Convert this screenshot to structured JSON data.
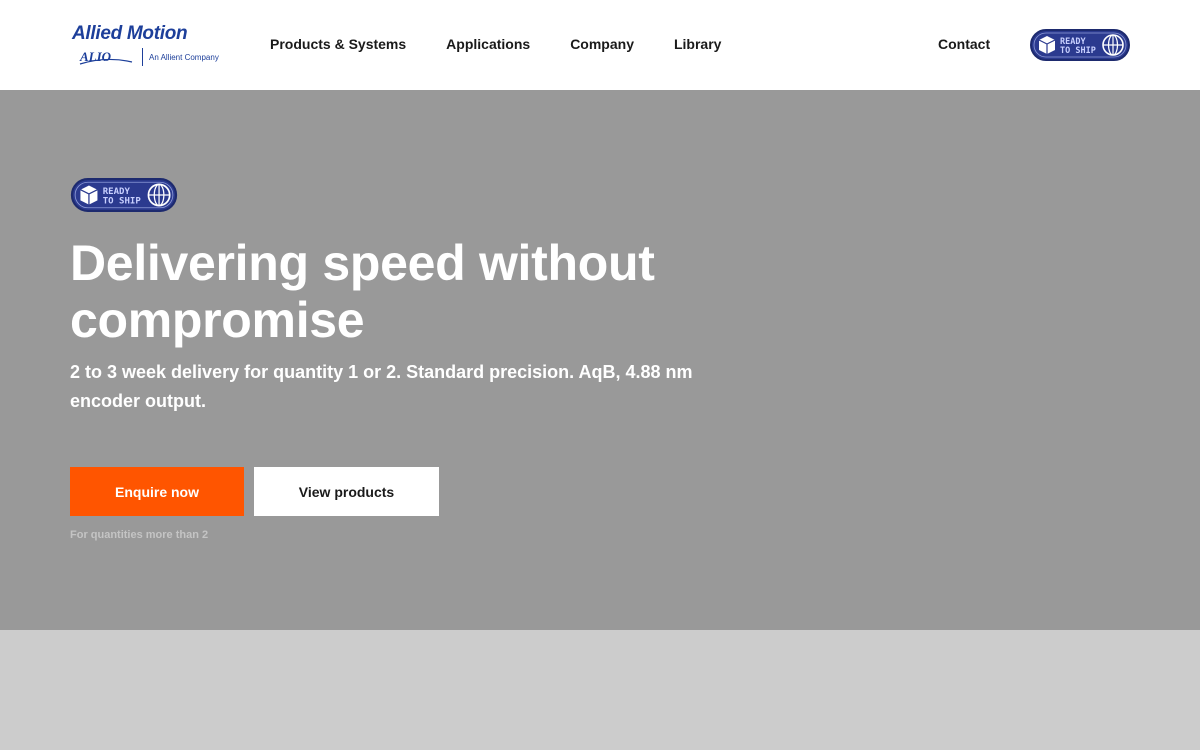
{
  "header": {
    "logo": {
      "brand": "Allied Motion",
      "sub_brand": "ALIO",
      "company_tag": "An Allient Company"
    },
    "nav": [
      {
        "label": "Products & Systems"
      },
      {
        "label": "Applications"
      },
      {
        "label": "Company"
      },
      {
        "label": "Library"
      }
    ],
    "contact_label": "Contact",
    "badge": {
      "line1": "READY",
      "line2": "TO SHIP"
    }
  },
  "hero": {
    "badge": {
      "line1": "READY",
      "line2": "TO SHIP"
    },
    "title": "Delivering speed without compromise",
    "subtitle": "2 to 3 week delivery for quantity 1 or 2. Standard precision. AqB, 4.88 nm encoder output.",
    "primary_button": "Enquire now",
    "secondary_button": "View products",
    "note": "For quantities more than 2"
  },
  "colors": {
    "brand_blue": "#1d3f9a",
    "accent_orange": "#ff5500",
    "hero_bg": "#999999",
    "page_bg": "#cccccc"
  }
}
